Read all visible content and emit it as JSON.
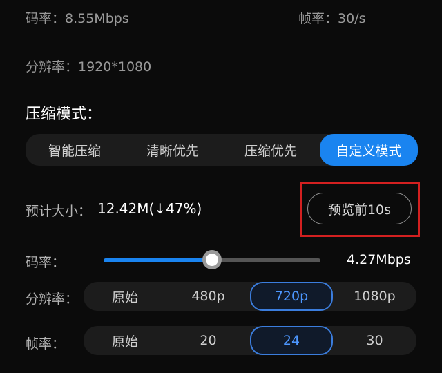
{
  "info": {
    "bitrate": "码率：8.55Mbps",
    "framerate": "帧率：30/s",
    "resolution": "分辨率：1920*1080"
  },
  "compression": {
    "title": "压缩模式：",
    "modes": [
      "智能压缩",
      "清晰优先",
      "压缩优先",
      "自定义模式"
    ],
    "selected_mode": "自定义模式"
  },
  "estimate": {
    "label": "预计大小：",
    "value": "12.42M(↓47%)"
  },
  "preview_button": "预览前10s",
  "bitrate_control": {
    "label": "码率：",
    "value": "4.27Mbps",
    "fraction": 0.5
  },
  "resolution_control": {
    "label": "分辨率：",
    "options": [
      "原始",
      "480p",
      "720p",
      "1080p"
    ],
    "selected": "720p"
  },
  "framerate_control": {
    "label": "帧率：",
    "options": [
      "原始",
      "20",
      "24",
      "30"
    ],
    "selected": "24"
  },
  "colors": {
    "accent": "#1a84f0",
    "highlight_box": "#d32020"
  }
}
